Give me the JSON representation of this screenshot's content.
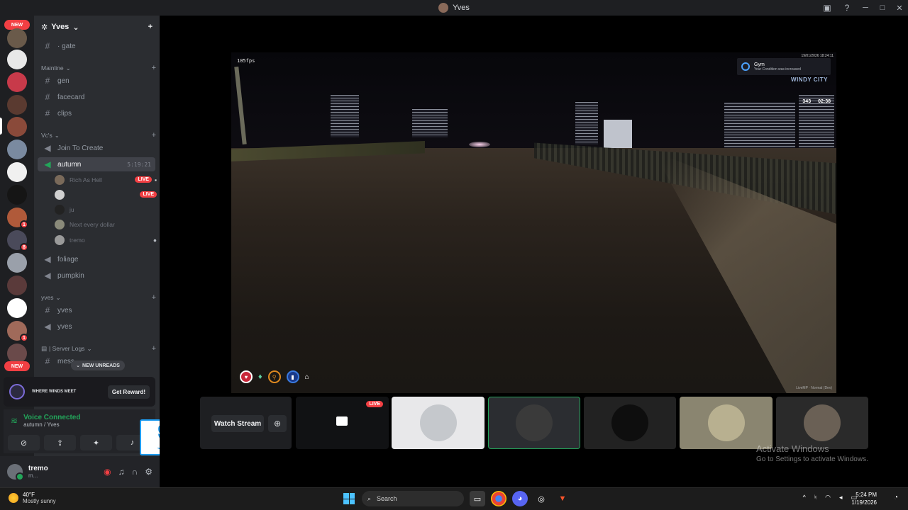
{
  "window": {
    "title": "Yves"
  },
  "rail": {
    "new_label_top": "NEW",
    "new_label_bottom": "NEW",
    "badges": [
      "1",
      "8",
      "1"
    ]
  },
  "server": {
    "name": "Yves"
  },
  "channels": {
    "gate": "· gate",
    "cat_mainline": "Mainline",
    "gen": "gen",
    "facecard": "facecard",
    "clips": "clips",
    "cat_vcs": "Vc's",
    "join_to_create": "Join To Create",
    "autumn": "autumn",
    "autumn_time": "5:19:21",
    "foliage": "foliage",
    "pumpkin": "pumpkin",
    "cat_yves": "yves",
    "yves_text": "yves",
    "yves_voice": "yves",
    "cat_logs": "| Server Logs",
    "messages": "mess"
  },
  "voice_users": [
    {
      "name": "Rich As Hell",
      "live": "LIVE"
    },
    {
      "name": "",
      "live": "LIVE"
    },
    {
      "name": "ju",
      "live": ""
    },
    {
      "name": "Next every dollar",
      "live": ""
    },
    {
      "name": "tremo",
      "live": ""
    }
  ],
  "new_unreads": "NEW UNREADS",
  "reward": {
    "brand": "WHERE WINDS MEET",
    "button": "Get Reward!"
  },
  "voice": {
    "status": "Voice Connected",
    "location": "autumn / Yves"
  },
  "user": {
    "name": "tremo",
    "status": "m..."
  },
  "stream_hud": {
    "fps": "105fps",
    "notif_title": "Gym",
    "notif_msg": "Your Condition was increased",
    "date": "19/01/2026 18:24:11",
    "city": "WINDY CITY",
    "stat_a": "343",
    "stat_b": "02:38",
    "footer": "LiveMP · Normal (Dev)"
  },
  "strip": {
    "watch": "Watch Stream",
    "live": "LIVE"
  },
  "activate": {
    "line1": "Activate Windows",
    "line2": "Go to Settings to activate Windows."
  },
  "taskbar": {
    "temp": "40°F",
    "weather": "Mostly sunny",
    "search": "Search",
    "time": "5:24 PM",
    "date": "1/19/2026"
  },
  "colors": {
    "accent_green": "#23a55a",
    "live_red": "#f23f43",
    "twitter_blue": "#1d9bf0"
  }
}
